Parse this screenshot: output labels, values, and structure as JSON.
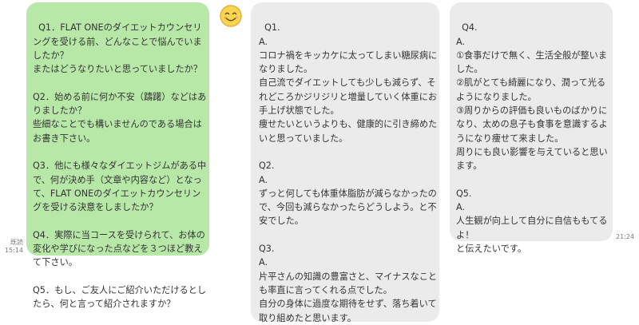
{
  "colors": {
    "sent_bubble": "#b7e8a8",
    "received_bubble": "#ebebeb"
  },
  "avatar": {
    "icon": "smiling-face-icon"
  },
  "messages": [
    {
      "text": "Q1．FLAT ONEのダイエットカウンセリングを受ける前、どんなことで悩んでいましたか？\nまたはどうなりたいと思っていましたか？\n\nQ2．始める前に何か不安（躊躇）などはありましたか？\n些細なことでも構いませんのである場合はお書き下さい。\n\nQ3．他にも様々なダイエットジムがある中で、何が決め手（文章や内容など）となって、FLAT ONEのダイエットカウンセリングを受ける決意をしましたか？\n\nQ4．実際に当コースを受けられて、お体の変化や学びになった点などを３つほど教えて下さい。\n\nQ5．もし、ご友人にご紹介いただけるとしたら、何と言って紹介されますか？",
      "read_label": "既読",
      "time": "15:14"
    },
    {
      "text": "Q1.\nA.\nコロナ禍をキッカケに太ってしまい糖尿病になりました。\n自己流でダイエットしても少しも減らず、それどころかジリジリと増量していく体重にお手上げ状態でした。\n痩せたいというよりも、健康的に引き締めたいと思っていました。\n\nQ2.\nA.\nずっと何しても体重体脂肪が減らなかったので、今回も減らなかったらどうしよう。と不安でした。\n\nQ3.\nA.\n片平さんの知識の豊富さと、マイナスなことも率直に言ってくれる点でした。\n自分の身体に過度な期待をせず、落ち着いて取り組めたと思います。"
    },
    {
      "text": "Q4.\nA.\n①食事だけで無く、生活全般が整いました。\n②肌がとても綺麗になり、潤って光るようになりました。\n③周りからの評価も良いものばかりになり、太めの息子も食事を意識するようになり痩せて来ました。\n周りにも良い影響を与えていると思います。\n\nQ5.\nA.\n人生観が向上して自分に自信ももてるよ！\nと伝えたいです。",
      "time": "21:24"
    }
  ]
}
